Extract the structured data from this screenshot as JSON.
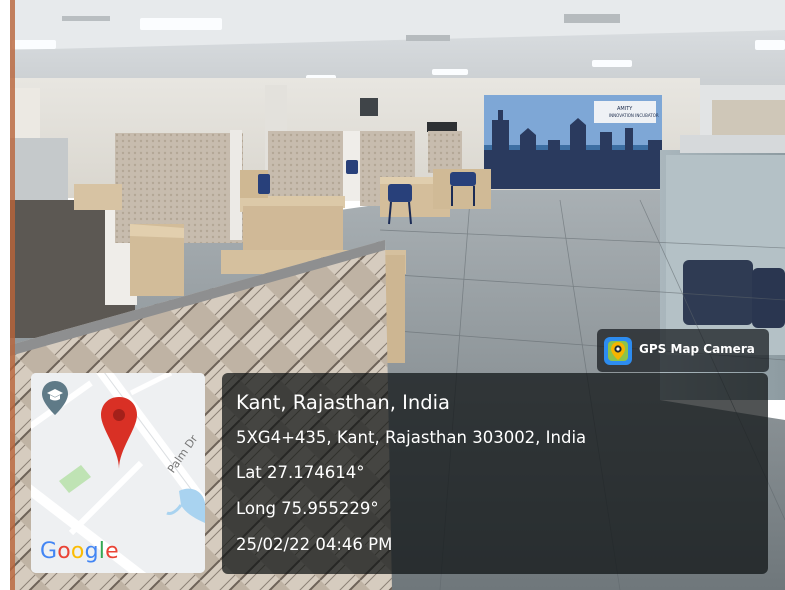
{
  "overlay": {
    "app_name": "GPS Map Camera",
    "place": "Kant, Rajasthan, India",
    "address": "5XG4+435, Kant, Rajasthan 303002, India",
    "latitude": "Lat 27.174614°",
    "longitude": "Long 75.955229°",
    "datetime": "25/02/22 04:46 PM"
  },
  "map": {
    "road_label": "Palm Dr",
    "brand": [
      "G",
      "o",
      "o",
      "g",
      "l",
      "e"
    ],
    "pin_color": "#D93025"
  },
  "photo": {
    "wall_banner": "AMITY INNOVATION INCUBATOR"
  },
  "colors": {
    "panel_bg": "#1a1f22",
    "text": "#ffffff",
    "google_blue": "#4285F4",
    "google_red": "#EA4335",
    "google_yellow": "#FBBC05",
    "google_green": "#34A853"
  }
}
